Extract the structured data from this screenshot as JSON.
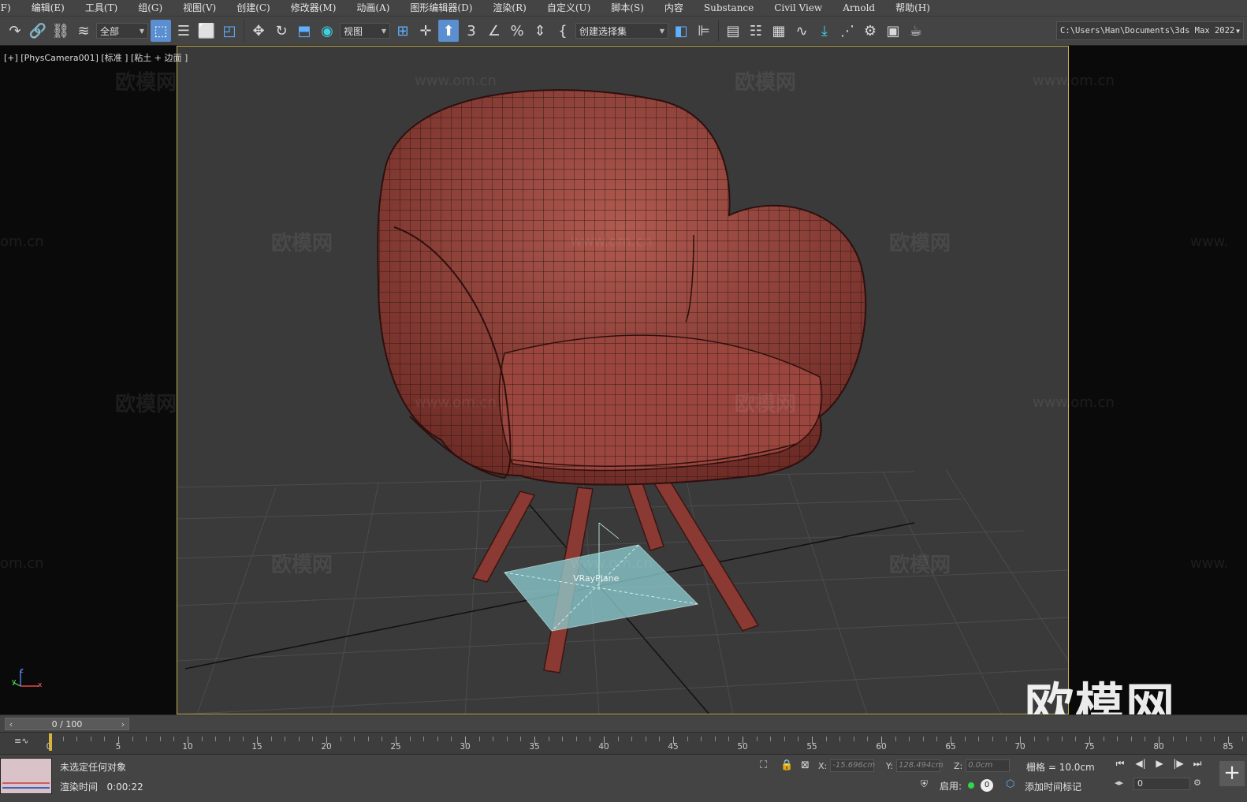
{
  "menu": [
    "(F)",
    "编辑(E)",
    "工具(T)",
    "组(G)",
    "视图(V)",
    "创建(C)",
    "修改器(M)",
    "动画(A)",
    "图形编辑器(D)",
    "渲染(R)",
    "自定义(U)",
    "脚本(S)",
    "内容",
    "Substance",
    "Civil View",
    "Arnold",
    "帮助(H)"
  ],
  "toolbar": {
    "filter_value": "全部",
    "refcoord_value": "视图",
    "selection_set_placeholder": "创建选择集",
    "project_path": "C:\\Users\\Han\\Documents\\3ds Max 2022",
    "snap_label": "3"
  },
  "viewport": {
    "label": "[+] [PhysCamera001] [标准 ] [粘土 + 边面 ]",
    "object_label": "VRayPlane",
    "watermark_cn": "欧模网",
    "watermark_url": "www.om.cn",
    "watermark_url_clipped": "om.cn",
    "watermark_url_clipped_right": "www.",
    "big_watermark": "欧模网",
    "axis_x": "x",
    "axis_y": "y",
    "axis_z": "z"
  },
  "timeline": {
    "frame_display": "0 / 100",
    "tick_labels": [
      "0",
      "5",
      "10",
      "15",
      "20",
      "25",
      "30",
      "35",
      "40",
      "45",
      "50",
      "55",
      "60",
      "65",
      "70",
      "75",
      "80",
      "85"
    ]
  },
  "status": {
    "selection": "未选定任何对象",
    "render_time_label": "渲染时间",
    "render_time_value": "0:00:22",
    "x_label": "X:",
    "x_value": "-15.696cm",
    "y_label": "Y:",
    "y_value": "128.494cm",
    "z_label": "Z:",
    "z_value": "0.0cm",
    "grid": "栅格 = 10.0cm",
    "enable_label": "启用:",
    "enable_count": "0",
    "add_time_tag": "添加时间标记",
    "frame_field": "0"
  },
  "colors": {
    "chair": "#8a3a33",
    "selection_border": "#c8b04a",
    "active_button": "#5b8fcf",
    "vray_plane": "#8fd0d4",
    "playhead": "#d8b43c"
  }
}
